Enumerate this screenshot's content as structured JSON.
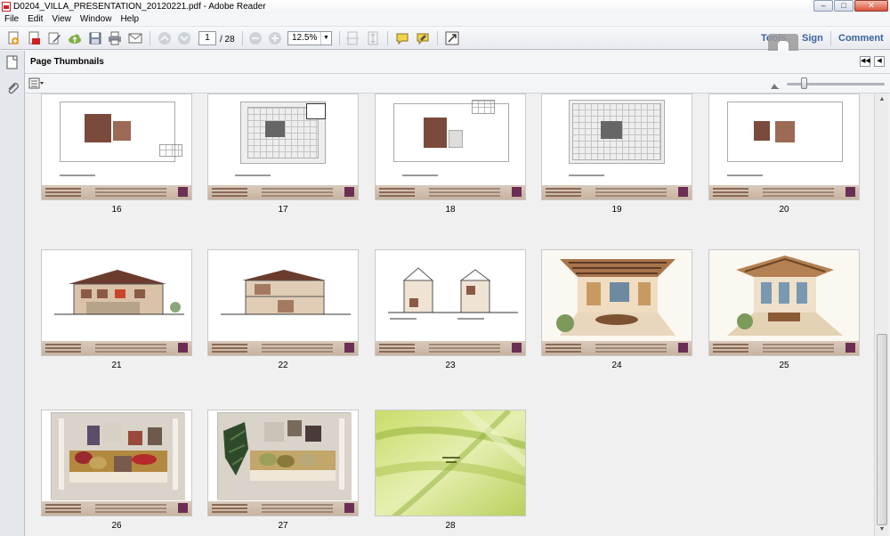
{
  "window": {
    "title": "D0204_VILLA_PRESENTATION_20120221.pdf - Adobe Reader",
    "controls": {
      "minimize": "–",
      "maximize": "□",
      "close": "✕"
    }
  },
  "menu": [
    "File",
    "Edit",
    "View",
    "Window",
    "Help"
  ],
  "toolbar": {
    "page_current": "1",
    "page_total": "/ 28",
    "zoom": "12.5%",
    "tools_label": "Tools",
    "sign_label": "Sign",
    "comment_label": "Comment"
  },
  "panel": {
    "title": "Page Thumbnails"
  },
  "thumbnails": [
    {
      "page": "16",
      "kind": "plan"
    },
    {
      "page": "17",
      "kind": "plan-detailed"
    },
    {
      "page": "18",
      "kind": "plan"
    },
    {
      "page": "19",
      "kind": "plan-detailed"
    },
    {
      "page": "20",
      "kind": "plan"
    },
    {
      "page": "21",
      "kind": "elevation"
    },
    {
      "page": "22",
      "kind": "elevation"
    },
    {
      "page": "23",
      "kind": "section"
    },
    {
      "page": "24",
      "kind": "rendering"
    },
    {
      "page": "25",
      "kind": "rendering"
    },
    {
      "page": "26",
      "kind": "material-board"
    },
    {
      "page": "27",
      "kind": "material-board"
    },
    {
      "page": "28",
      "kind": "thank-you"
    }
  ],
  "colors": {
    "link_blue": "#3b63a0",
    "footer_band": "#c7b3a0",
    "plan_brown": "#7a4a3c"
  }
}
